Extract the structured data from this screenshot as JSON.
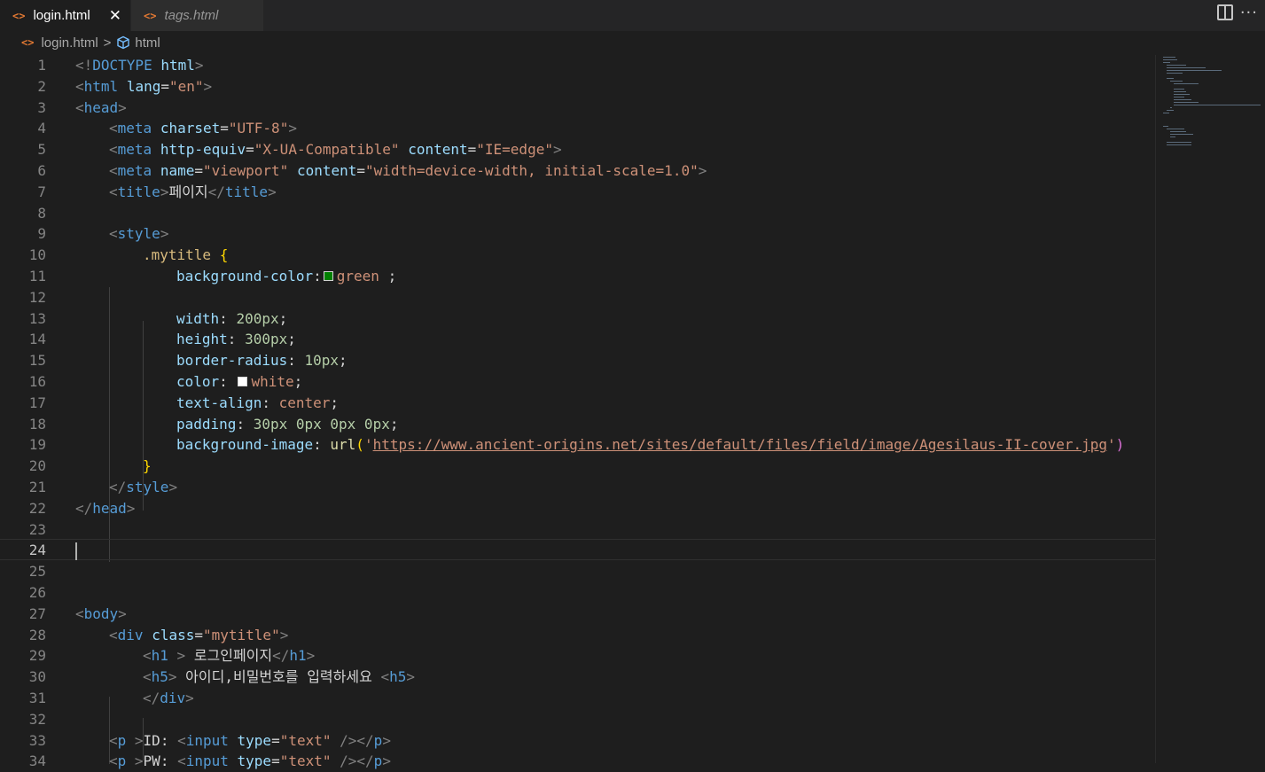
{
  "tabs": [
    {
      "label": "login.html",
      "active": true
    },
    {
      "label": "tags.html",
      "active": false
    }
  ],
  "icons": {
    "file_icon": "<>",
    "close_icon": "✕",
    "split_editor": "split-editor-icon",
    "more_actions": "···"
  },
  "breadcrumb": {
    "file": "login.html",
    "separator": ">",
    "symbol": "html"
  },
  "editor": {
    "current_line": 24,
    "swatch_colors": {
      "green": "#008000",
      "white": "#ffffff"
    },
    "line_numbers": [
      "1",
      "2",
      "3",
      "4",
      "5",
      "6",
      "7",
      "8",
      "9",
      "10",
      "11",
      "12",
      "13",
      "14",
      "15",
      "16",
      "17",
      "18",
      "19",
      "20",
      "21",
      "22",
      "23",
      "24",
      "25",
      "26",
      "27",
      "28",
      "29",
      "30",
      "31",
      "32",
      "33",
      "34"
    ],
    "lines": {
      "l1": [
        "<!",
        "DOCTYPE",
        " ",
        "html",
        ">"
      ],
      "l2": [
        "<",
        "html",
        " ",
        "lang",
        "=",
        "\"en\"",
        ">"
      ],
      "l3": [
        "<",
        "head",
        ">"
      ],
      "l4": [
        "<",
        "meta",
        " ",
        "charset",
        "=",
        "\"UTF-8\"",
        ">"
      ],
      "l5": [
        "<",
        "meta",
        " ",
        "http-equiv",
        "=",
        "\"X-UA-Compatible\"",
        " ",
        "content",
        "=",
        "\"IE=edge\"",
        ">"
      ],
      "l6": [
        "<",
        "meta",
        " ",
        "name",
        "=",
        "\"viewport\"",
        " ",
        "content",
        "=",
        "\"width=device-width, initial-scale=1.0\"",
        ">"
      ],
      "l7": [
        "<",
        "title",
        ">",
        "페이지",
        "</",
        "title",
        ">"
      ],
      "l9": [
        "<",
        "style",
        ">"
      ],
      "l10": [
        ".mytitle",
        " ",
        "{"
      ],
      "l11": [
        "background-color",
        ":",
        "green",
        " ;"
      ],
      "l13": [
        "width",
        ": ",
        "200px",
        ";"
      ],
      "l14": [
        "height",
        ": ",
        "300px",
        ";"
      ],
      "l15": [
        "border-radius",
        ": ",
        "10px",
        ";"
      ],
      "l16": [
        "color",
        ": ",
        "white",
        ";"
      ],
      "l17": [
        "text-align",
        ": ",
        "center",
        ";"
      ],
      "l18": [
        "padding",
        ": ",
        "30px 0px 0px 0px",
        ";"
      ],
      "l19": [
        "background-image",
        ": ",
        "url",
        "(",
        "'",
        "https://www.ancient-origins.net/sites/default/files/field/image/Agesilaus-II-cover.jpg",
        "'",
        ")"
      ],
      "l20": [
        "}"
      ],
      "l21": [
        "</",
        "style",
        ">"
      ],
      "l22": [
        "</",
        "head",
        ">"
      ],
      "l27": [
        "<",
        "body",
        ">"
      ],
      "l28": [
        "<",
        "div",
        " ",
        "class",
        "=",
        "\"mytitle\"",
        ">"
      ],
      "l29": [
        "<",
        "h1",
        " > ",
        "로그인페이지",
        "</",
        "h1",
        ">"
      ],
      "l30": [
        "<",
        "h5",
        ">",
        " 아이디,비밀번호를 입력하세요 ",
        "<",
        "h5",
        ">"
      ],
      "l31": [
        "</",
        "div",
        ">"
      ],
      "l33": [
        "<",
        "p",
        " >",
        "ID: ",
        "<",
        "input",
        " ",
        "type",
        "=",
        "\"text\"",
        " />",
        "</",
        "p",
        ">"
      ],
      "l34": [
        "<",
        "p",
        " >",
        "PW: ",
        "<",
        "input",
        " ",
        "type",
        "=",
        "\"text\"",
        " />",
        "</",
        "p",
        ">"
      ]
    }
  }
}
